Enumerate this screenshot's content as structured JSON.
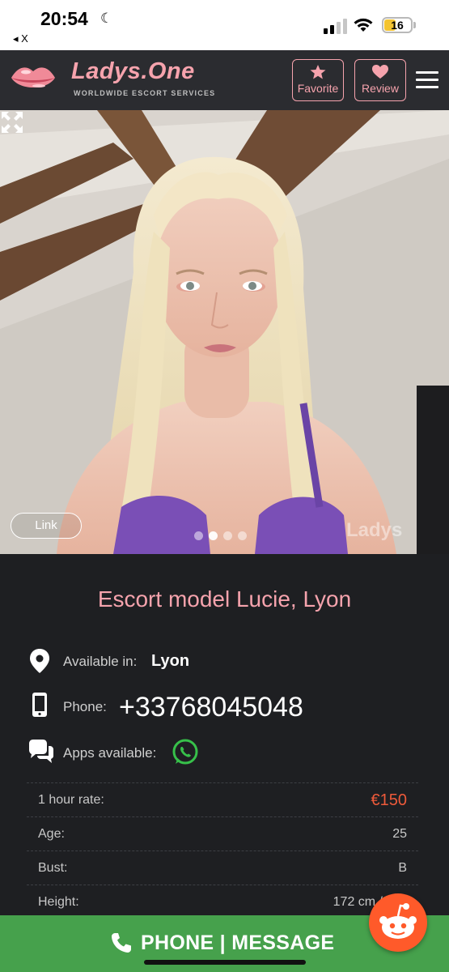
{
  "status_bar": {
    "time": "20:54",
    "back_label": "◂ X",
    "battery": "16"
  },
  "header": {
    "logo_title": "Ladys.One",
    "logo_subtitle": "WORLDWIDE ESCORT SERVICES",
    "favorite_label": "Favorite",
    "review_label": "Review",
    "accent": "#f6a3ad"
  },
  "gallery": {
    "link_label": "Link",
    "watermark": "Ladys",
    "slide_count": 4,
    "active_slide": 2
  },
  "profile": {
    "title": "Escort model Lucie, Lyon",
    "available_label": "Available in:",
    "city": "Lyon",
    "phone_label": "Phone:",
    "phone": "+33768045048",
    "apps_label": "Apps available:",
    "rows": [
      {
        "key": "1 hour rate:",
        "value": "€150"
      },
      {
        "key": "Age:",
        "value": "25"
      },
      {
        "key": "Bust:",
        "value": "B"
      },
      {
        "key": "Height:",
        "value": "172 cm /"
      }
    ]
  },
  "bottom_bar": {
    "cta": "PHONE | MESSAGE",
    "color": "#46a14c"
  }
}
